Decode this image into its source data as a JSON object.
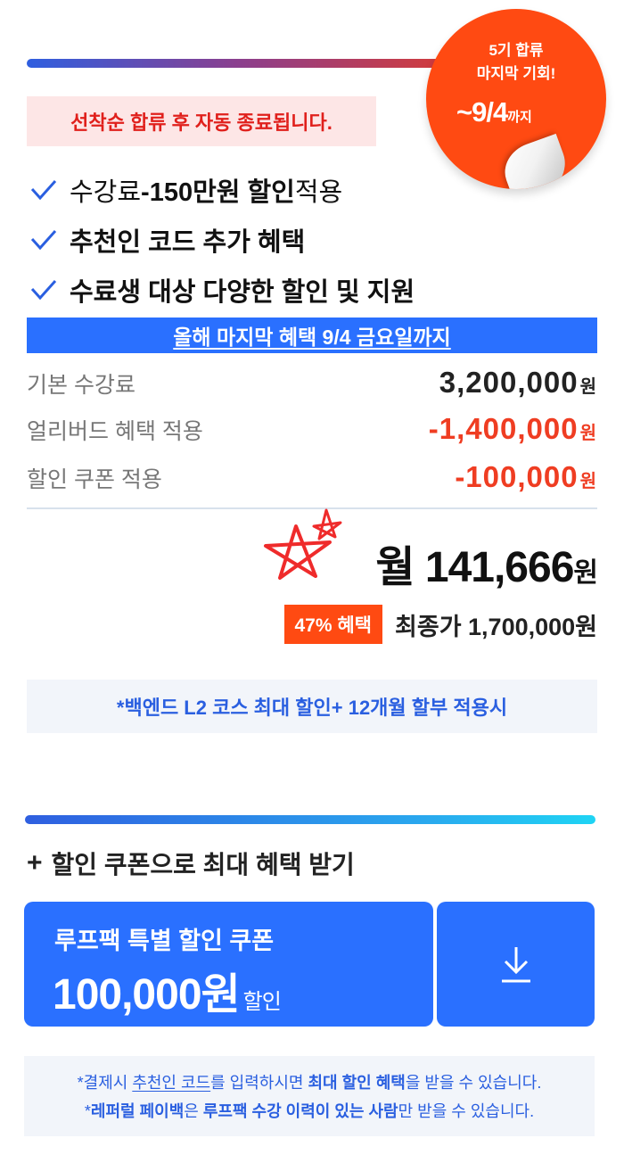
{
  "badge": {
    "line1": "5기 합류",
    "line2": "마지막 기회!",
    "date": "~9/4",
    "date_suffix": "까지",
    "color": "#ff4a12"
  },
  "notice": "선착순 합류 후 자동 종료됩니다.",
  "benefits": {
    "item1_bold": "수강료",
    "item1_strong": " -150만원 할인",
    "item1_tail": " 적용",
    "item2": "추천인 코드 추가 혜택",
    "item3": "수료생 대상 다양한 할인 및 지원"
  },
  "banner": "올해 마지막 혜택 9/4 금요일까지",
  "pricing": {
    "base_label": "기본 수강료",
    "base_value": "3,200,000",
    "early_label": "얼리버드 혜택 적용",
    "early_value": "-1,400,000",
    "coupon_label": "할인 쿠폰 적용",
    "coupon_value": "-100,000",
    "currency": "원"
  },
  "monthly": {
    "prefix": "월 ",
    "value": "141,666",
    "unit": "원"
  },
  "final": {
    "discount_badge": "47% 혜택",
    "final_label": "최종가 1,700,000원"
  },
  "condition_note": "*백엔드 L2 코스 최대 할인+ 12개월 할부 적용시",
  "coupon_section": {
    "plus": "+",
    "heading": "할인 쿠폰으로 최대 혜택 받기",
    "card_title": "루프팩 특별 할인 쿠폰",
    "card_amount": "100,000원",
    "card_suffix": "할인",
    "download_icon": "download-icon"
  },
  "footnote": {
    "l1_a": "*결제시 ",
    "l1_b": "추천인 코드",
    "l1_c": "를 입력하시면 ",
    "l1_d": "최대 할인 혜택",
    "l1_e": "을 받을 수 있습니다.",
    "l2_a": "*",
    "l2_b": "레퍼럴 페이백",
    "l2_c": "은 ",
    "l2_d": "루프팩 수강 이력이 있는 사람",
    "l2_e": "만 받을 수 있습니다."
  },
  "colors": {
    "accent_blue": "#2a70ff",
    "accent_red": "#ef3d22",
    "notice_bg": "#fde6e6"
  }
}
